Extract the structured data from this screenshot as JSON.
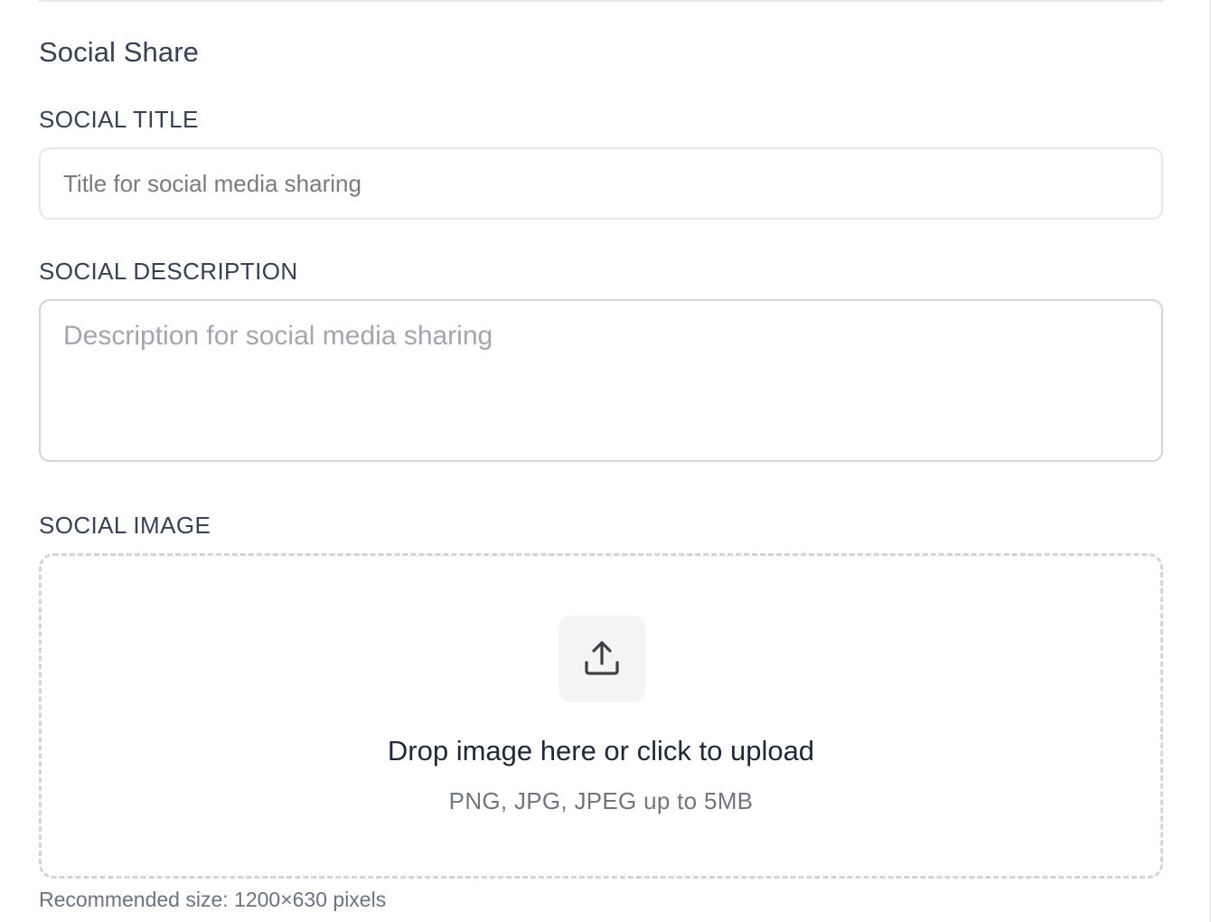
{
  "section": {
    "title": "Social Share"
  },
  "social_title": {
    "label": "SOCIAL TITLE",
    "value": "",
    "placeholder": "Title for social media sharing"
  },
  "social_description": {
    "label": "SOCIAL DESCRIPTION",
    "value": "",
    "placeholder": "Description for social media sharing"
  },
  "social_image": {
    "label": "SOCIAL IMAGE",
    "icon": "upload-icon",
    "drop_text": "Drop image here or click to upload",
    "formats_text": "PNG, JPG, JPEG up to 5MB",
    "hint": "Recommended size: 1200×630 pixels"
  },
  "colors": {
    "label_text": "#374151",
    "input_border": "#e5e7eb",
    "placeholder": "#7b7b7b",
    "dropzone_border": "#d4d4d4",
    "icon_bg": "#f4f4f5"
  }
}
